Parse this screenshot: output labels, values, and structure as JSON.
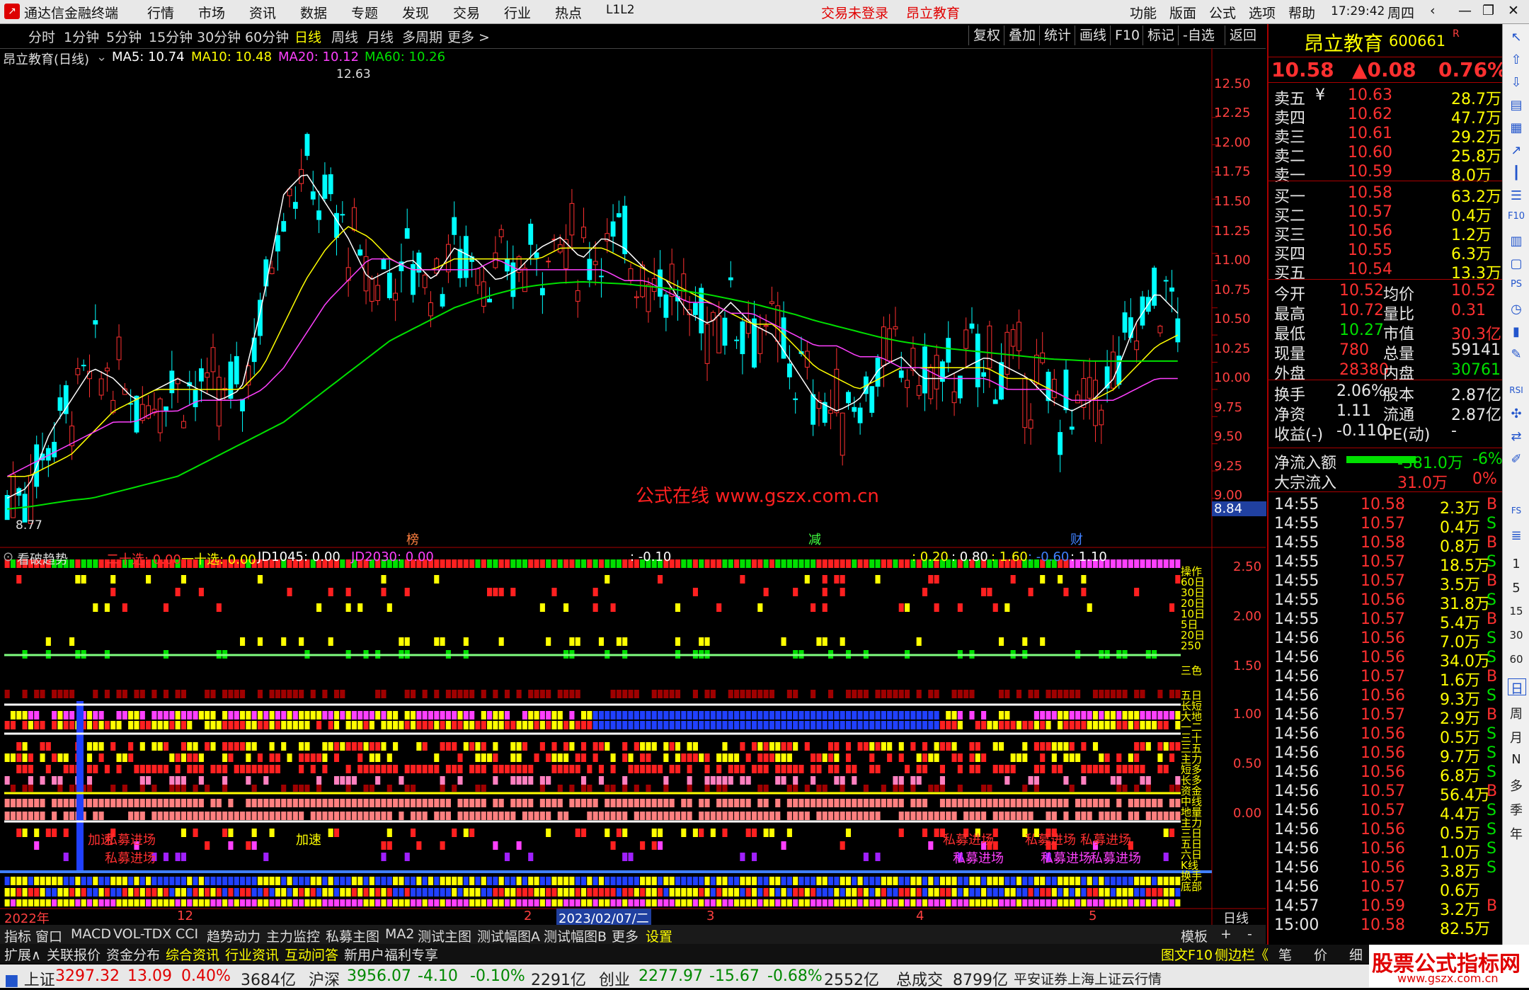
{
  "titlebar": {
    "app_name": "通达信金融终端",
    "menu": [
      "行情",
      "市场",
      "资讯",
      "数据",
      "专题",
      "发现",
      "交易",
      "行业",
      "热点",
      "L1L2"
    ],
    "login": "交易未登录",
    "brand": "昂立教育",
    "right_menu": [
      "功能",
      "版面",
      "公式",
      "选项",
      "帮助"
    ],
    "time": "17:29:42",
    "weekday": "周四"
  },
  "periods": [
    "分时",
    "1分钟",
    "5分钟",
    "15分钟",
    "30分钟",
    "60分钟",
    "日线",
    "周线",
    "月线",
    "多周期",
    "更多 >"
  ],
  "active_period": "日线",
  "chart_buttons": [
    "复权",
    "叠加",
    "统计",
    "画线",
    "F10",
    "标记",
    "-自选",
    "返回"
  ],
  "ma_legend": {
    "name": "昂立教育(日线)",
    "ma5": "MA5: 10.74",
    "ma10": "MA10: 10.48",
    "ma20": "MA20: 10.12",
    "ma60": "MA60: 10.26"
  },
  "indicator_legend": {
    "name": "看破趋势",
    "items": [
      "二十选: 0.00",
      "一十选: 0.00",
      "JD1045: 0.00",
      "JD2030: 0.00",
      ": -0.10",
      ": 0.20",
      ": 0.80",
      ": 1.60",
      ": -0.60",
      ": 1.10"
    ]
  },
  "watermark": "公式在线  www.gszx.com.cn",
  "price_axis": [
    "12.50",
    "12.25",
    "12.00",
    "11.75",
    "11.50",
    "11.25",
    "11.00",
    "10.75",
    "10.50",
    "10.25",
    "10.00",
    "9.75",
    "9.50",
    "9.25",
    "9.00"
  ],
  "price_badge": "8.84",
  "ind_axis": [
    "2.50",
    "2.00",
    "1.50",
    "1.00",
    "0.50",
    "0.00"
  ],
  "high_label": "12.63",
  "low_label": "8.77",
  "event_markers": [
    "榜",
    "减",
    "财"
  ],
  "signal_labels": [
    "加速",
    "私募进场",
    "私募进场",
    "私募进场",
    "私募进场",
    "私募进场",
    "加速",
    "私募进场",
    "私募进场",
    "私募进场"
  ],
  "side_labels": [
    "操作",
    "60日",
    "30日",
    "20日",
    "10日",
    "5日",
    "20日",
    "250",
    "三色",
    "五日",
    "长短",
    "大地",
    "一二",
    "三十",
    "三五",
    "主力",
    "短多",
    "长多",
    "资金",
    "中线",
    "地量",
    "主力",
    "三日",
    "五日",
    "六日",
    "K线",
    "换手",
    "底部"
  ],
  "date_axis": {
    "year": "2022年",
    "m12": "12",
    "date": "2023/02/07/二",
    "m2": "2",
    "m3": "3",
    "m4": "4",
    "m5": "5",
    "period": "日线"
  },
  "bottom_tabs": [
    "指标",
    "窗口",
    "MACD",
    "VOL-TDX",
    "CCI",
    "趋势动力",
    "主力监控",
    "私募主图",
    "MA2",
    "测试主图",
    "测试幅图A",
    "测试幅图B",
    "更多",
    "设置"
  ],
  "bottom_right": [
    "模板",
    "+",
    "-"
  ],
  "bottom_tabs2": [
    "扩展∧",
    "关联报价",
    "资金分布",
    "综合资讯",
    "行业资讯",
    "互动问答",
    "新用户福利专享"
  ],
  "bottom_tabs2_right": [
    "图文F10",
    "侧边栏《",
    "笔",
    "价",
    "细",
    "势"
  ],
  "quote": {
    "name": "昂立教育",
    "code": "600661",
    "mark": "R",
    "price": "10.58",
    "change": "▲0.08",
    "pct": "0.76%",
    "asks": [
      [
        "卖五",
        "¥",
        "10.63",
        "28.7万"
      ],
      [
        "卖四",
        "",
        "10.62",
        "47.7万"
      ],
      [
        "卖三",
        "",
        "10.61",
        "29.2万"
      ],
      [
        "卖二",
        "",
        "10.60",
        "25.8万"
      ],
      [
        "卖一",
        "",
        "10.59",
        "8.0万"
      ]
    ],
    "bids": [
      [
        "买一",
        "10.58",
        "63.2万"
      ],
      [
        "买二",
        "10.57",
        "0.4万"
      ],
      [
        "买三",
        "10.56",
        "1.2万"
      ],
      [
        "买四",
        "10.55",
        "6.3万"
      ],
      [
        "买五",
        "10.54",
        "13.3万"
      ]
    ],
    "stats": [
      [
        "今开",
        "10.52",
        "均价",
        "10.52"
      ],
      [
        "最高",
        "10.72",
        "量比",
        "0.31"
      ],
      [
        "最低",
        "10.27",
        "市值",
        "30.3亿"
      ],
      [
        "现量",
        "780",
        "总量",
        "59141"
      ],
      [
        "外盘",
        "28380",
        "内盘",
        "30761"
      ]
    ],
    "stats2": [
      [
        "换手",
        "2.06%",
        "股本",
        "2.87亿"
      ],
      [
        "净资",
        "1.11",
        "流通",
        "2.87亿"
      ],
      [
        "收益(-)",
        "-0.110",
        "PE(动)",
        "-"
      ]
    ],
    "flows": [
      [
        "净流入额",
        "-381.0万",
        "-6%"
      ],
      [
        "大宗流入",
        "31.0万",
        "0%"
      ]
    ],
    "ticks": [
      [
        "14:55",
        "10.58",
        "2.3万",
        "B"
      ],
      [
        "14:55",
        "10.57",
        "0.4万",
        "S"
      ],
      [
        "14:55",
        "10.58",
        "0.8万",
        "B"
      ],
      [
        "14:55",
        "10.57",
        "18.5万",
        "S"
      ],
      [
        "14:55",
        "10.57",
        "3.5万",
        "B"
      ],
      [
        "14:55",
        "10.56",
        "31.8万",
        "S"
      ],
      [
        "14:55",
        "10.57",
        "5.4万",
        "B"
      ],
      [
        "14:56",
        "10.56",
        "7.0万",
        "S"
      ],
      [
        "14:56",
        "10.56",
        "34.0万",
        "S"
      ],
      [
        "14:56",
        "10.57",
        "1.6万",
        "B"
      ],
      [
        "14:56",
        "10.56",
        "9.3万",
        "S"
      ],
      [
        "14:56",
        "10.57",
        "2.9万",
        "B"
      ],
      [
        "14:56",
        "10.56",
        "0.5万",
        "S"
      ],
      [
        "14:56",
        "10.56",
        "9.7万",
        "S"
      ],
      [
        "14:56",
        "10.56",
        "6.8万",
        "S"
      ],
      [
        "14:56",
        "10.57",
        "56.4万",
        "B"
      ],
      [
        "14:56",
        "10.57",
        "4.4万",
        "S"
      ],
      [
        "14:56",
        "10.56",
        "0.5万",
        "S"
      ],
      [
        "14:56",
        "10.56",
        "1.0万",
        "S"
      ],
      [
        "14:56",
        "10.56",
        "3.8万",
        "S"
      ],
      [
        "14:56",
        "10.57",
        "0.6万",
        ""
      ],
      [
        "14:57",
        "10.59",
        "3.2万",
        "B"
      ],
      [
        "15:00",
        "10.58",
        "82.5万",
        ""
      ]
    ]
  },
  "sidebar_right": [
    "日",
    "周",
    "月",
    "N",
    "多",
    "季",
    "年",
    "15",
    "30",
    "60",
    "1",
    "5",
    "RSI"
  ],
  "status": {
    "items": [
      {
        "name": "上证",
        "v": "3297.32",
        "c": "13.09",
        "p": "0.40%",
        "a": "3684亿"
      },
      {
        "name": "沪深",
        "v": "3956.07",
        "c": "-4.10",
        "p": "-0.10%",
        "a": "2291亿"
      },
      {
        "name": "创业",
        "v": "2277.97",
        "c": "-15.67",
        "p": "-0.68%",
        "a": "2552亿"
      }
    ],
    "total_label": "总成交",
    "total": "8799亿",
    "provider": "平安证券上海上证云行情",
    "logo": "股票公式指标网",
    "logo_url": "www.gszx.com.cn"
  },
  "colors": {
    "up": "#ff3030",
    "down": "#00ffff",
    "ma5": "#ffffff",
    "ma10": "#ffff00",
    "ma20": "#ff40ff",
    "ma60": "#00e000"
  },
  "chart_data": {
    "type": "candlestick",
    "ylim": [
      8.84,
      12.63
    ],
    "series": [
      {
        "name": "MA5",
        "values": [
          9.0,
          9.1,
          9.6,
          9.9,
          10.2,
          10.1,
          9.9,
          10.0,
          10.1,
          10.0,
          9.9,
          10.0,
          10.8,
          11.8,
          12.0,
          11.7,
          11.4,
          11.0,
          11.1,
          11.2,
          11.0,
          11.3,
          11.2,
          11.0,
          11.1,
          11.3,
          11.4,
          11.2,
          11.4,
          11.3,
          11.1,
          11.0,
          10.7,
          10.6,
          10.8,
          10.6,
          10.5,
          10.2,
          9.9,
          9.8,
          9.9,
          10.2,
          10.3,
          10.1,
          10.1,
          10.2,
          10.3,
          10.2,
          10.1,
          9.9,
          9.8,
          9.9,
          10.1,
          10.6,
          10.9,
          10.7
        ]
      },
      {
        "name": "MA10",
        "values": [
          9.2,
          9.2,
          9.3,
          9.4,
          9.6,
          9.8,
          9.9,
          10.0,
          10.0,
          10.0,
          10.0,
          10.0,
          10.2,
          10.6,
          11.0,
          11.3,
          11.5,
          11.4,
          11.2,
          11.1,
          11.1,
          11.2,
          11.2,
          11.2,
          11.2,
          11.2,
          11.3,
          11.3,
          11.3,
          11.2,
          11.1,
          11.0,
          10.9,
          10.8,
          10.7,
          10.6,
          10.6,
          10.4,
          10.2,
          10.1,
          10.0,
          10.1,
          10.2,
          10.2,
          10.2,
          10.2,
          10.2,
          10.1,
          10.1,
          10.0,
          9.9,
          9.9,
          10.0,
          10.2,
          10.4,
          10.5
        ]
      },
      {
        "name": "MA20",
        "values": [
          9.2,
          9.3,
          9.4,
          9.5,
          9.6,
          9.7,
          9.7,
          9.8,
          9.8,
          9.9,
          9.9,
          9.9,
          10.0,
          10.2,
          10.5,
          10.8,
          11.0,
          11.2,
          11.2,
          11.1,
          11.1,
          11.1,
          11.1,
          11.2,
          11.1,
          11.1,
          11.1,
          11.1,
          11.1,
          11.0,
          11.0,
          10.9,
          10.8,
          10.8,
          10.7,
          10.7,
          10.6,
          10.5,
          10.4,
          10.4,
          10.3,
          10.3,
          10.2,
          10.2,
          10.1,
          10.1,
          10.1,
          10.0,
          10.0,
          10.0,
          9.9,
          9.9,
          9.9,
          10.0,
          10.1,
          10.1
        ]
      },
      {
        "name": "MA60",
        "values": [
          8.9,
          8.92,
          8.95,
          8.98,
          9.0,
          9.05,
          9.1,
          9.15,
          9.2,
          9.3,
          9.4,
          9.5,
          9.6,
          9.7,
          9.85,
          10.0,
          10.15,
          10.3,
          10.45,
          10.55,
          10.65,
          10.75,
          10.82,
          10.88,
          10.93,
          10.96,
          10.98,
          10.99,
          10.98,
          10.97,
          10.95,
          10.93,
          10.9,
          10.87,
          10.83,
          10.79,
          10.74,
          10.69,
          10.63,
          10.58,
          10.53,
          10.48,
          10.44,
          10.41,
          10.38,
          10.36,
          10.34,
          10.32,
          10.3,
          10.28,
          10.27,
          10.26,
          10.26,
          10.26,
          10.26,
          10.26
        ]
      }
    ]
  }
}
